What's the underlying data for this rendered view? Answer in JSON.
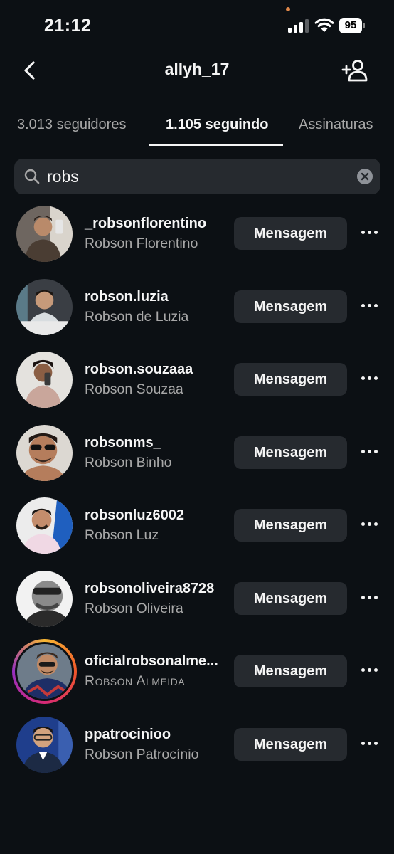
{
  "status_bar": {
    "time": "21:12",
    "battery_level": "95",
    "signal_bars_active": 3,
    "signal_bars_total": 4
  },
  "nav": {
    "title": "allyh_17",
    "back_icon": "chevron-left-icon",
    "add_user_icon": "add-person-icon"
  },
  "tabs": [
    {
      "label": "3.013 seguidores",
      "active": false
    },
    {
      "label": "1.105 seguindo",
      "active": true
    },
    {
      "label": "Assinaturas",
      "active": false
    }
  ],
  "search": {
    "value": "robs",
    "icon": "search-icon",
    "clear_icon": "clear-icon"
  },
  "users": [
    {
      "username": "_robsonflorentino",
      "name": "Robson Florentino",
      "button": "Mensagem",
      "has_story": false
    },
    {
      "username": "robson.luzia",
      "name": "Robson de Luzia",
      "button": "Mensagem",
      "has_story": false
    },
    {
      "username": "robson.souzaaa",
      "name": "Robson Souzaa",
      "button": "Mensagem",
      "has_story": false
    },
    {
      "username": "robsonms_",
      "name": "Robson Binho",
      "button": "Mensagem",
      "has_story": false
    },
    {
      "username": "robsonluz6002",
      "name": "Robson Luz",
      "button": "Mensagem",
      "has_story": false
    },
    {
      "username": "robsonoliveira8728",
      "name": "Robson Oliveira",
      "button": "Mensagem",
      "has_story": false
    },
    {
      "username": "oficialrobsonalme...",
      "name": "Robson Almeida",
      "button": "Mensagem",
      "has_story": true
    },
    {
      "username": "ppatrocinioo",
      "name": "Robson Patrocínio",
      "button": "Mensagem",
      "has_story": false
    }
  ],
  "colors": {
    "background": "#0c1014",
    "button_bg": "#262a2f",
    "secondary_text": "#a8a8a8",
    "primary_text": "#f5f5f5"
  }
}
